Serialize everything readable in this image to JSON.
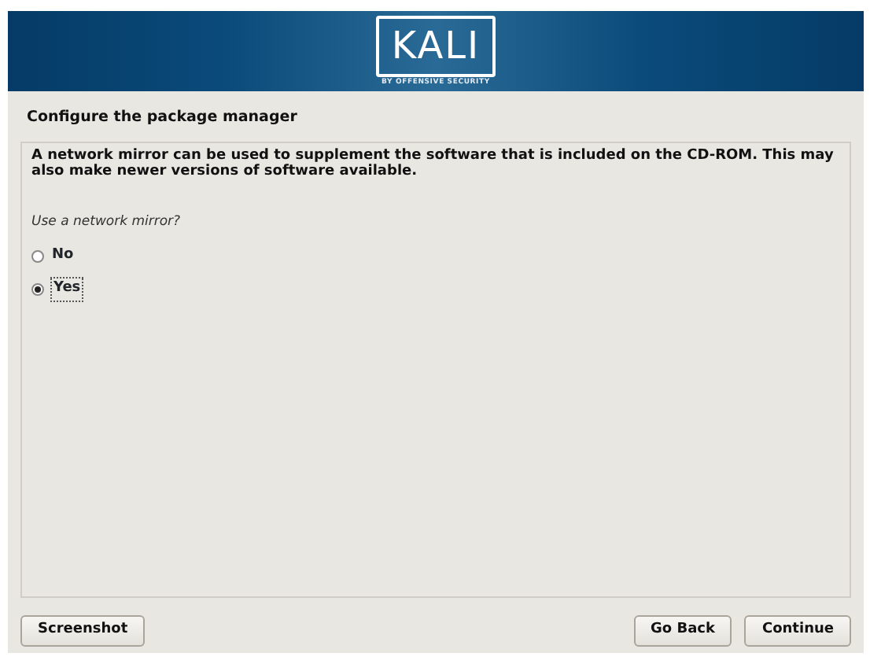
{
  "banner": {
    "logo": "KALI",
    "tagline": "BY OFFENSIVE SECURITY"
  },
  "title": "Configure the package manager",
  "description": "A network mirror can be used to supplement the software that is included on the CD-ROM. This may also make newer versions of software available.",
  "question": "Use a network mirror?",
  "options": [
    {
      "label": "No",
      "selected": false
    },
    {
      "label": "Yes",
      "selected": true
    }
  ],
  "buttons": {
    "left": [
      "Screenshot"
    ],
    "right": [
      "Go Back",
      "Continue"
    ]
  }
}
